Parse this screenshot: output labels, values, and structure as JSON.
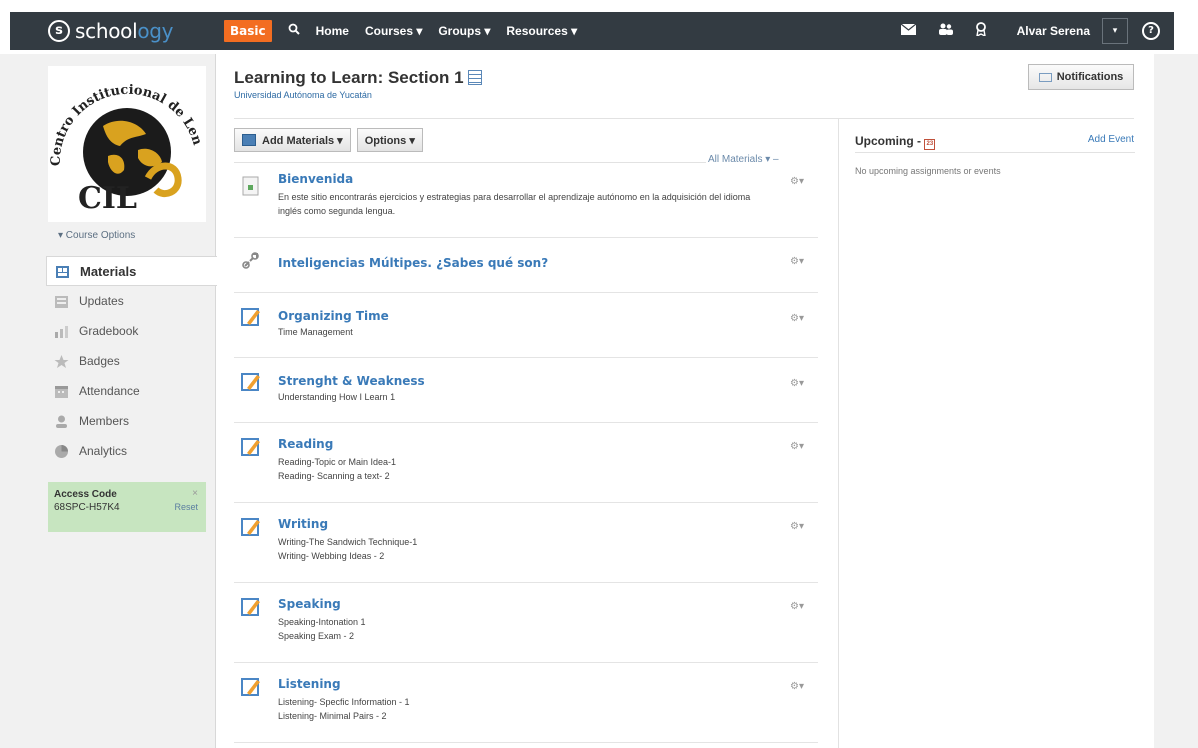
{
  "nav": {
    "logo_prefix": "school",
    "logo_suffix": "ogy",
    "logo_mark": "s",
    "basic": "Basic",
    "home": "Home",
    "courses": "Courses ▾",
    "groups": "Groups ▾",
    "resources": "Resources ▾",
    "user": "Alvar Serena",
    "help": "?"
  },
  "sidebar": {
    "course_options": "▾  Course Options",
    "items": [
      {
        "label": "Materials",
        "icon": "materials-icon"
      },
      {
        "label": "Updates",
        "icon": "updates-icon"
      },
      {
        "label": "Gradebook",
        "icon": "gradebook-icon"
      },
      {
        "label": "Badges",
        "icon": "badges-icon"
      },
      {
        "label": "Attendance",
        "icon": "attendance-icon"
      },
      {
        "label": "Members",
        "icon": "members-icon"
      },
      {
        "label": "Analytics",
        "icon": "analytics-icon"
      }
    ],
    "access": {
      "title": "Access Code",
      "code": "68SPC-H57K4",
      "reset": "Reset",
      "close": "×"
    },
    "logo": {
      "arc_text": "Centro Institucional de Lenguas",
      "letters": "CIL"
    }
  },
  "header": {
    "title": "Learning to Learn: Section 1",
    "subtitle": "Universidad Autónoma de Yucatán",
    "notifications": "Notifications"
  },
  "toolbar": {
    "add_materials": "Add Materials ▾",
    "options": "Options ▾",
    "all_materials": "All Materials  ▾  –"
  },
  "materials": [
    {
      "title": "Bienvenida",
      "desc": [
        "En este sitio encontrarás ejercicios y estrategias para desarrollar el aprendizaje autónomo en la adquisición del idioma inglés como segunda lengua."
      ],
      "icon": "page-icon"
    },
    {
      "title": "Inteligencias Múltipes. ¿Sabes qué son?",
      "desc": [],
      "icon": "link-icon"
    },
    {
      "title": "Organizing Time",
      "desc": [
        "Time Management"
      ],
      "icon": "assignment-icon"
    },
    {
      "title": "Strenght & Weakness",
      "desc": [
        "Understanding How I Learn 1"
      ],
      "icon": "assignment-icon"
    },
    {
      "title": "Reading",
      "desc": [
        "Reading-Topic or Main Idea-1",
        "Reading- Scanning a text- 2"
      ],
      "icon": "assignment-icon"
    },
    {
      "title": "Writing",
      "desc": [
        "Writing-The Sandwich Technique-1",
        "Writing- Webbing Ideas - 2"
      ],
      "icon": "assignment-icon"
    },
    {
      "title": "Speaking",
      "desc": [
        "Speaking-Intonation 1",
        "Speaking Exam - 2"
      ],
      "icon": "assignment-icon"
    },
    {
      "title": "Listening",
      "desc": [
        "Listening- Specfic Information - 1",
        "Listening- Minimal Pairs - 2"
      ],
      "icon": "assignment-icon"
    }
  ],
  "upcoming": {
    "title": "Upcoming",
    "cal_day": "23",
    "add_event": "Add Event",
    "empty": "No upcoming assignments or events"
  },
  "colors": {
    "nav_bg": "#333b42",
    "basic": "#f36d21",
    "link": "#3a7ab8",
    "access_bg": "#c7e5c0"
  }
}
